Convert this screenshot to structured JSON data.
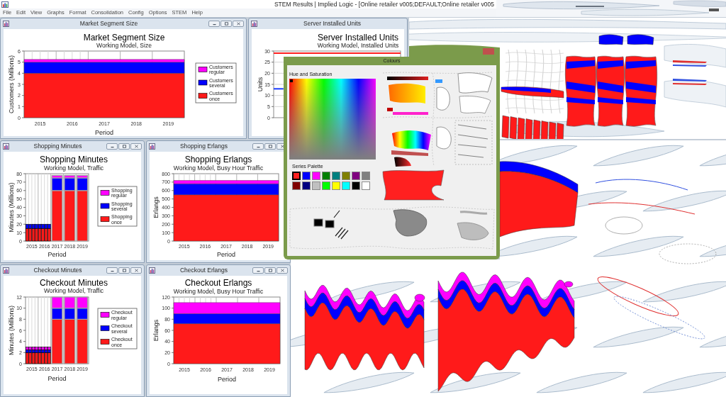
{
  "window": {
    "title": "STEM Results | Implied Logic - [Online retailer v005;DEFAULT;Online retailer v005"
  },
  "menu_bar": {
    "items": [
      "File",
      "Edit",
      "View",
      "Graphs",
      "Format",
      "Consolidation",
      "Config",
      "Options",
      "STEM",
      "Help"
    ]
  },
  "chart_windows": [
    {
      "title": "Market Segment Size",
      "subtitle": "Working Model, Size",
      "chart_data": {
        "type": "area",
        "title": "Market Segment Size",
        "xlabel": "Period",
        "ylabel": "Customers (Millions)",
        "x": [
          2015,
          2020
        ],
        "series": [
          {
            "name": "Customers once",
            "color": "#ff1a1a",
            "values": [
              4,
              4
            ]
          },
          {
            "name": "Customers several",
            "color": "#0000ff",
            "values": [
              1,
              1
            ]
          },
          {
            "name": "Customers regular",
            "color": "#ff00ff",
            "values": [
              0.25,
              0.25
            ]
          }
        ],
        "xlim": [
          2015,
          2020
        ],
        "ylim": [
          0,
          6
        ],
        "xticks": [
          {
            "value": 2015.5,
            "label": "2015"
          },
          {
            "value": 2016.5,
            "label": "2016"
          },
          {
            "value": 2017.5,
            "label": "2017"
          },
          {
            "value": 2018.5,
            "label": "2018"
          },
          {
            "value": 2019.5,
            "label": "2019"
          }
        ],
        "yticks": [
          0,
          1,
          2,
          3,
          4,
          5,
          6
        ],
        "stacked": true,
        "grid": true,
        "legend": "right"
      }
    },
    {
      "title": "Server Installed Units",
      "subtitle": "Working Model, Installed Units",
      "chart_data": {
        "type": "line",
        "title": "Server Installed Units",
        "ylabel": "Units",
        "series": [
          {
            "color": "#ff2020",
            "values": [
              29,
              29,
              29,
              29,
              29,
              29,
              29,
              29,
              29,
              29,
              29,
              29,
              29,
              29
            ]
          },
          {
            "color": "#1a3cff",
            "values": [
              13,
              13,
              null,
              null,
              null,
              null,
              null,
              null,
              null,
              null,
              null,
              null,
              null,
              null
            ]
          }
        ],
        "ylim": [
          0,
          30
        ],
        "yticks": [
          0,
          5,
          10,
          15,
          20,
          25,
          30
        ],
        "stacked": false,
        "grid": true
      }
    },
    {
      "title": "Shopping Minutes",
      "subtitle": "Working Model, Traffic",
      "chart_data": {
        "type": "bar",
        "title": "Shopping Minutes",
        "xlabel": "Period",
        "ylabel": "Minutes (Millions)",
        "x": [
          2015.125,
          2015.375,
          2015.625,
          2015.875,
          2016.125,
          2016.375,
          2016.625,
          2016.875,
          2017.5,
          2018.5,
          2019.5
        ],
        "series": [
          {
            "name": "Shopping once",
            "color": "#ff1a1a",
            "values": [
              15,
              15,
              15,
              15,
              15,
              15,
              15,
              15,
              60,
              60,
              60
            ]
          },
          {
            "name": "Shopping several",
            "color": "#0000ff",
            "values": [
              5,
              5,
              5,
              5,
              5,
              5,
              5,
              5,
              15,
              15,
              15
            ]
          },
          {
            "name": "Shopping regular",
            "color": "#ff00ff",
            "values": [
              0,
              0,
              0,
              0,
              0,
              0,
              0,
              0,
              3,
              3,
              3
            ]
          }
        ],
        "xlim": [
          2015,
          2020
        ],
        "ylim": [
          0,
          80
        ],
        "xticks": [
          {
            "value": 2015.5,
            "label": "2015"
          },
          {
            "value": 2016.5,
            "label": "2016"
          },
          {
            "value": 2017.5,
            "label": "2017"
          },
          {
            "value": 2018.5,
            "label": "2018"
          },
          {
            "value": 2019.5,
            "label": "2019"
          }
        ],
        "yticks": [
          0,
          10,
          20,
          30,
          40,
          50,
          60,
          70,
          80
        ],
        "stacked": true,
        "grid": true,
        "legend": "right"
      }
    },
    {
      "title": "Shopping Erlangs",
      "subtitle": "Working Model, Busy Hour Traffic",
      "chart_data": {
        "type": "area",
        "title": "Shopping Erlangs",
        "xlabel": "Period",
        "ylabel": "Erlangs",
        "x": [
          2015,
          2020
        ],
        "series": [
          {
            "color": "#ff1a1a",
            "values": [
              550,
              550
            ]
          },
          {
            "color": "#0000ff",
            "values": [
              130,
              130
            ]
          },
          {
            "color": "#ff00ff",
            "values": [
              40,
              40
            ]
          }
        ],
        "xlim": [
          2015,
          2020
        ],
        "ylim": [
          0,
          800
        ],
        "xticks": [
          {
            "value": 2015.5,
            "label": "2015"
          },
          {
            "value": 2016.5,
            "label": "2016"
          },
          {
            "value": 2017.5,
            "label": "2017"
          },
          {
            "value": 2018.5,
            "label": "2018"
          },
          {
            "value": 2019.5,
            "label": "2019"
          }
        ],
        "yticks": [
          0,
          100,
          200,
          300,
          400,
          500,
          600,
          700,
          800
        ],
        "stacked": true,
        "grid": true
      }
    },
    {
      "title": "Checkout Minutes",
      "subtitle": "Working Model, Traffic",
      "chart_data": {
        "type": "bar",
        "title": "Checkout Minutes",
        "xlabel": "Period",
        "ylabel": "Minutes (Millions)",
        "x": [
          2015.125,
          2015.375,
          2015.625,
          2015.875,
          2016.125,
          2016.375,
          2016.625,
          2016.875,
          2017.5,
          2018.5,
          2019.5
        ],
        "series": [
          {
            "name": "Checkout once",
            "color": "#ff1a1a",
            "values": [
              2,
              2,
              2,
              2,
              2,
              2,
              2,
              2,
              8,
              8,
              8
            ]
          },
          {
            "name": "Checkout several",
            "color": "#0000ff",
            "values": [
              0.5,
              0.5,
              0.5,
              0.5,
              0.5,
              0.5,
              0.5,
              0.5,
              2,
              2,
              2
            ]
          },
          {
            "name": "Checkout regular",
            "color": "#ff00ff",
            "values": [
              0.5,
              0.5,
              0.5,
              0.5,
              0.5,
              0.5,
              0.5,
              0.5,
              2,
              2,
              2
            ]
          }
        ],
        "xlim": [
          2015,
          2020
        ],
        "ylim": [
          0,
          12
        ],
        "xticks": [
          {
            "value": 2015.5,
            "label": "2015"
          },
          {
            "value": 2016.5,
            "label": "2016"
          },
          {
            "value": 2017.5,
            "label": "2017"
          },
          {
            "value": 2018.5,
            "label": "2018"
          },
          {
            "value": 2019.5,
            "label": "2019"
          }
        ],
        "yticks": [
          0,
          2,
          4,
          6,
          8,
          10,
          12
        ],
        "stacked": true,
        "grid": true,
        "legend": "right"
      }
    },
    {
      "title": "Checkout Erlangs",
      "subtitle": "Working Model, Busy Hour Traffic",
      "chart_data": {
        "type": "area",
        "title": "Checkout Erlangs",
        "xlabel": "Period",
        "ylabel": "Erlangs",
        "x": [
          2015,
          2020
        ],
        "series": [
          {
            "color": "#ff1a1a",
            "values": [
              72,
              72
            ]
          },
          {
            "color": "#0000ff",
            "values": [
              18,
              18
            ]
          },
          {
            "color": "#ff00ff",
            "values": [
              20,
              20
            ]
          }
        ],
        "xlim": [
          2015,
          2020
        ],
        "ylim": [
          0,
          120
        ],
        "xticks": [
          {
            "value": 2015.5,
            "label": "2015"
          },
          {
            "value": 2016.5,
            "label": "2016"
          },
          {
            "value": 2017.5,
            "label": "2017"
          },
          {
            "value": 2018.5,
            "label": "2018"
          },
          {
            "value": 2019.5,
            "label": "2019"
          }
        ],
        "yticks": [
          0,
          20,
          40,
          60,
          80,
          100,
          120
        ],
        "stacked": true,
        "grid": true
      }
    }
  ],
  "colours_dialog": {
    "title": "Colours",
    "hue_saturation_label": "Hue and Saturation",
    "series_palette": {
      "label": "Series Palette",
      "swatches": [
        {
          "color": "#ff2020",
          "selected": true
        },
        {
          "color": "#0000ff",
          "selected": false
        },
        {
          "color": "#ff00ff",
          "selected": false
        },
        {
          "color": "#008000",
          "selected": false
        },
        {
          "color": "#008080",
          "selected": false
        },
        {
          "color": "#808000",
          "selected": false
        },
        {
          "color": "#800080",
          "selected": false
        },
        {
          "color": "#808080",
          "selected": false
        },
        {
          "color": "#800000",
          "selected": false
        },
        {
          "color": "#000080",
          "selected": false
        },
        {
          "color": "#c0c0c0",
          "selected": false
        },
        {
          "color": "#00ff00",
          "selected": false
        },
        {
          "color": "#ffff00",
          "selected": false
        },
        {
          "color": "#00ffff",
          "selected": false
        },
        {
          "color": "#000000",
          "selected": false
        },
        {
          "color": "#ffffff",
          "selected": false
        }
      ]
    }
  }
}
